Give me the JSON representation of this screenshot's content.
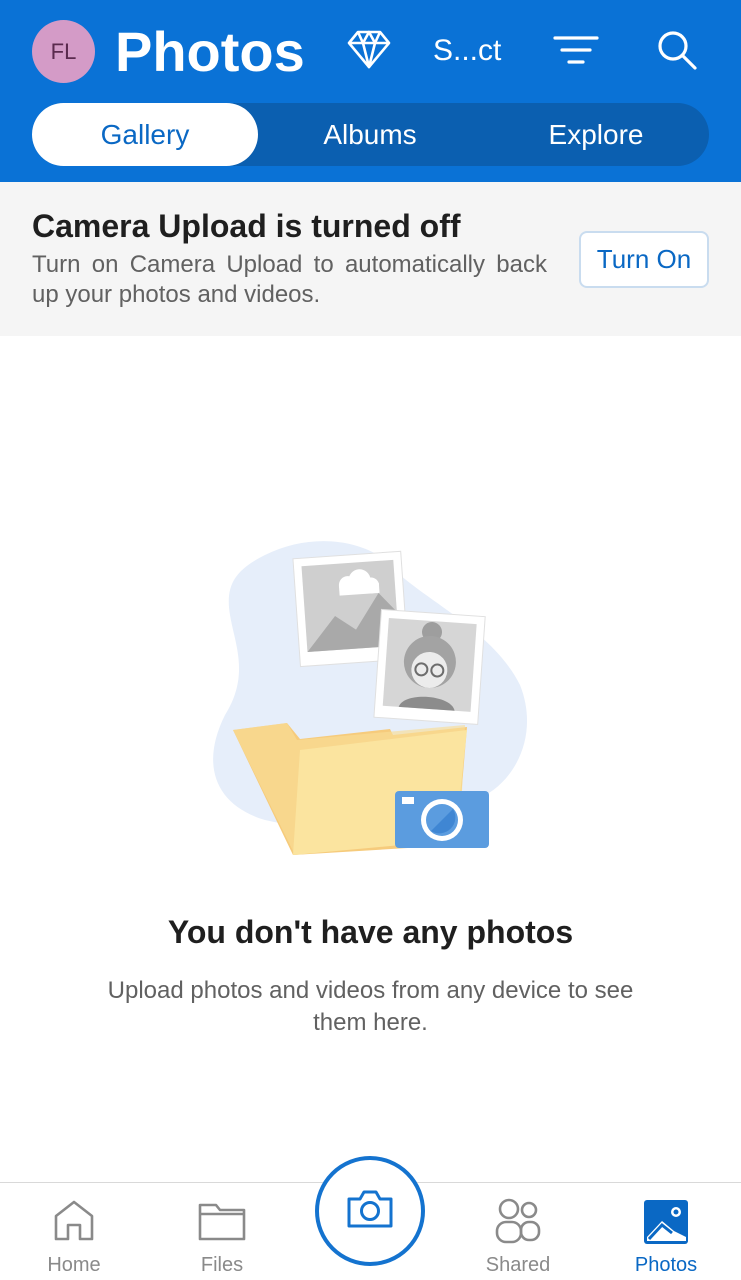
{
  "header": {
    "avatar_initials": "FL",
    "title": "Photos",
    "select_label": "S...ct",
    "icons": [
      "premium-diamond-icon",
      "filter-icon",
      "search-icon"
    ],
    "tabs": [
      {
        "label": "Gallery",
        "active": true
      },
      {
        "label": "Albums",
        "active": false
      },
      {
        "label": "Explore",
        "active": false
      }
    ],
    "colors": {
      "bar": "#0a72d6",
      "segment": "#0b5fb0"
    }
  },
  "banner": {
    "title": "Camera Upload is turned off",
    "text": "Turn on Camera Upload to automatically back up your photos and videos.",
    "button_label": "Turn On"
  },
  "empty_state": {
    "illustration": "folder-with-photos-and-camera",
    "title": "You don't have any photos",
    "text": "Upload photos and videos from any device to see them here."
  },
  "bottom_nav": {
    "items": [
      {
        "label": "Home",
        "icon": "home-icon",
        "active": false
      },
      {
        "label": "Files",
        "icon": "folder-icon",
        "active": false
      },
      {
        "label": "Shared",
        "icon": "people-icon",
        "active": false
      },
      {
        "label": "Photos",
        "icon": "photo-icon",
        "active": true
      }
    ],
    "center_button_icon": "camera-icon",
    "accent_color": "#0a68c4"
  }
}
